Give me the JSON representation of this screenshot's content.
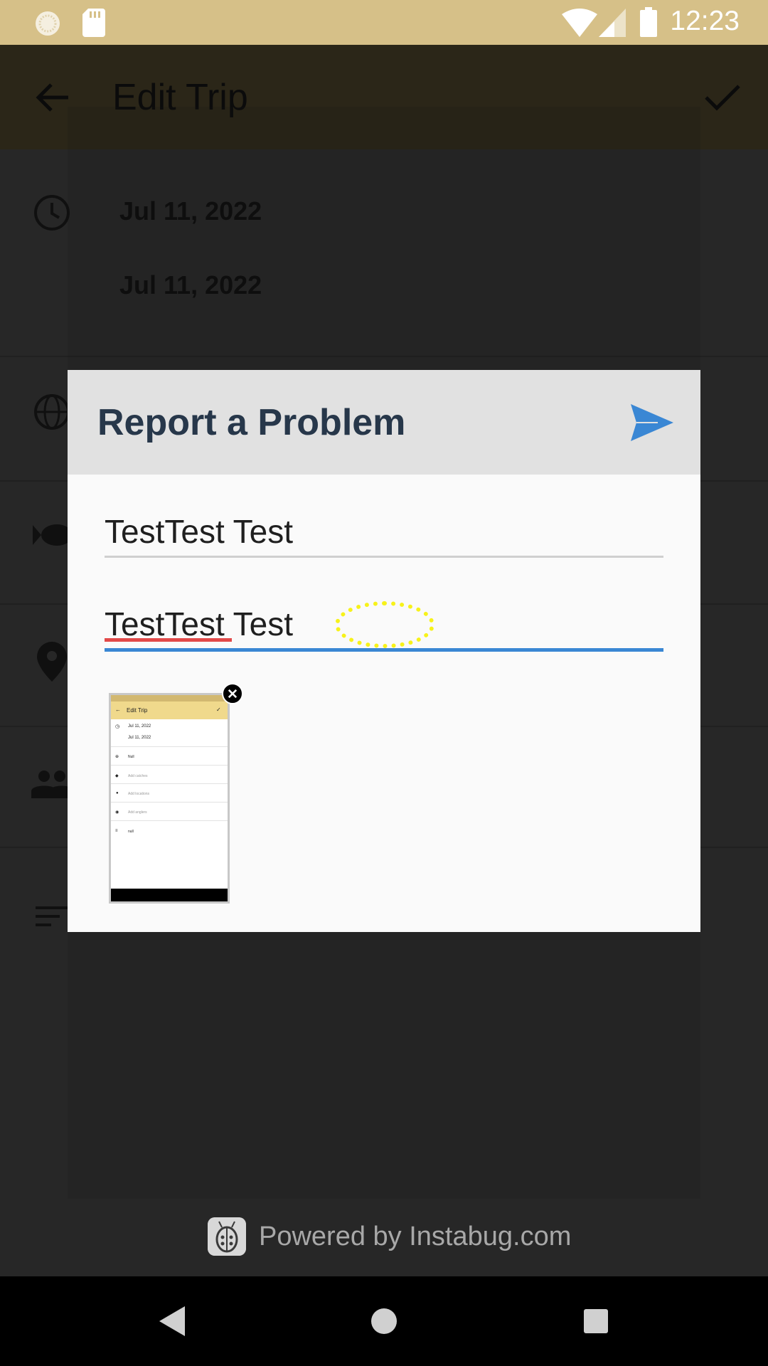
{
  "status_bar": {
    "time": "12:23",
    "icons": [
      "sun-badge-icon",
      "sd-card-icon",
      "wifi-icon",
      "signal-icon",
      "battery-icon"
    ]
  },
  "app": {
    "title": "Edit Trip",
    "dates": [
      "Jul 11, 2022",
      "Jul 11, 2022"
    ],
    "icons": [
      "back-arrow-icon",
      "check-icon",
      "clock-icon",
      "globe-icon",
      "fish-icon",
      "location-pin-icon",
      "people-icon",
      "notes-icon"
    ]
  },
  "dialog": {
    "title": "Report a Problem",
    "field_email_value": "TestTest Test",
    "field_message_value": "TestTest Test"
  },
  "thumbnail": {
    "title": "Edit Trip",
    "date_1": "Jul 11, 2022",
    "date_2": "Jul 11, 2022",
    "rows": [
      "Null",
      "Add catches",
      "Add locations",
      "Add anglers",
      "null"
    ]
  },
  "footer": {
    "powered_by": "Powered by Instabug.com"
  },
  "colors": {
    "status_bar": "#d6c088",
    "dialog_title": "#27374a",
    "send_accent": "#3a87d4",
    "spell_error": "#e24949",
    "touch_indicator": "#f7f21a"
  }
}
